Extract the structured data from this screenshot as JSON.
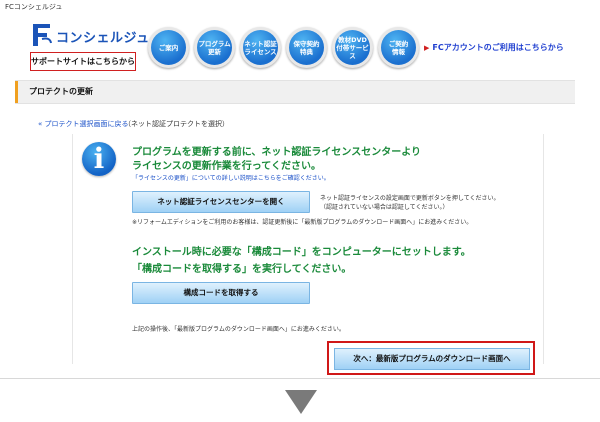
{
  "window": {
    "title": "FCコンシェルジュ"
  },
  "header": {
    "logo_fc": "FC",
    "logo_text": "コンシェルジュ",
    "support_label": "サポートサイトはこちらから",
    "nav": [
      {
        "label": "ご案内",
        "icon": "info-nav-icon"
      },
      {
        "label": "プログラム\n更新",
        "icon": "program-update-icon"
      },
      {
        "label": "ネット認証\nライセンス",
        "icon": "net-license-icon"
      },
      {
        "label": "保守契約\n特典",
        "icon": "maintenance-icon"
      },
      {
        "label": "教材DVD\n付帯サービス",
        "icon": "dvd-icon"
      },
      {
        "label": "ご契約\n情報",
        "icon": "contract-icon"
      }
    ],
    "fc_account_link": "FCアカウントのご利用はこちらから"
  },
  "page": {
    "title": "プロテクトの更新",
    "back_link": "« プロテクト選択画面に戻る",
    "back_sub": "（ネット認証プロテクトを選択）"
  },
  "message1": {
    "line1": "プログラムを更新する前に、ネット認証ライセンスセンターより",
    "line2": "ライセンスの更新作業を行ってください。",
    "note": "「ライセンスの更新」についての詳しい説明はこちらをご確認ください。"
  },
  "license_button": {
    "label": "ネット認証ライセンスセンターを開く",
    "note1": "ネット認証ライセンスの設定画面で更新ボタンを押してください。",
    "note2": "（認証されていない場合は認証してください。）",
    "note3": "※リフォームエディションをご利用のお客様は、認証更新後に「最新版プログラムのダウンロード画面へ」にお進みください。"
  },
  "message2": {
    "line1": "インストール時に必要な「構成コード」をコンピューターにセットします。",
    "line2": "「構成コードを取得する」を実行してください。"
  },
  "config_button": {
    "label": "構成コードを取得する"
  },
  "after_note": "上記の操作後、「最新版プログラムのダウンロード画面へ」にお進みください。",
  "next_button": {
    "label": "次へ：最新版プログラムのダウンロード画面へ"
  },
  "colors": {
    "accent_blue": "#1a6fcf",
    "message_green": "#1a8a3a",
    "highlight_red": "#d01818",
    "link_blue": "#1a50c8"
  }
}
